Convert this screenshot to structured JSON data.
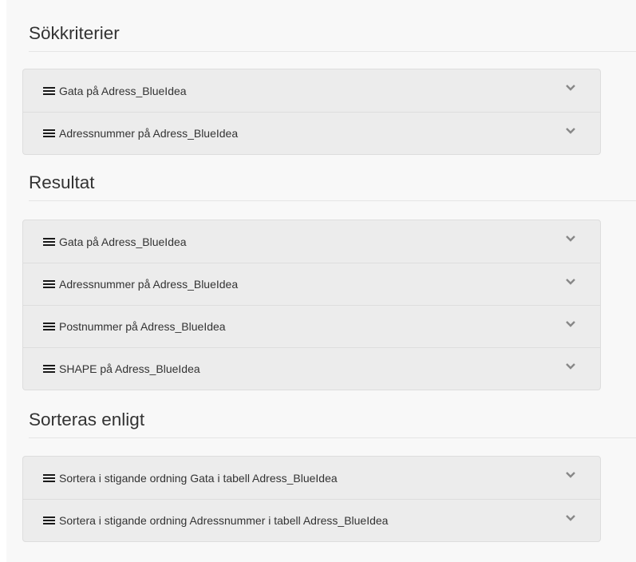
{
  "sections": [
    {
      "title": "Sökkriterier",
      "items": [
        {
          "label": "Gata på Adress_BlueIdea"
        },
        {
          "label": "Adressnummer på Adress_BlueIdea"
        }
      ]
    },
    {
      "title": "Resultat",
      "items": [
        {
          "label": "Gata på Adress_BlueIdea"
        },
        {
          "label": "Adressnummer på Adress_BlueIdea"
        },
        {
          "label": "Postnummer på Adress_BlueIdea"
        },
        {
          "label": "SHAPE på Adress_BlueIdea"
        }
      ]
    },
    {
      "title": "Sorteras enligt",
      "items": [
        {
          "label": "Sortera i stigande ordning Gata i tabell Adress_BlueIdea"
        },
        {
          "label": "Sortera i stigande ordning Adressnummer i tabell Adress_BlueIdea"
        }
      ]
    }
  ],
  "icons": {
    "drag": "menu-icon",
    "expand": "chevron-down-icon"
  }
}
